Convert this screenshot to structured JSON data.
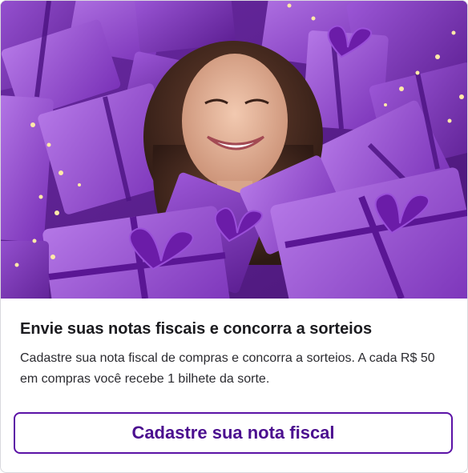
{
  "hero": {
    "image": "purple-gift-boxes-smiling-woman-photo"
  },
  "promo": {
    "title": "Envie suas notas fiscais e concorra a sorteios",
    "description": "Cadastre sua nota fiscal de compras e concorra a sorteios. A cada R$ 50 em compras você recebe 1 bilhete da sorte.",
    "cta_label": "Cadastre sua nota fiscal"
  },
  "colors": {
    "accent": "#5b12a6",
    "accent_text": "#4b0f8f",
    "gift_purple": "#8a3fc7",
    "title_text": "#1b1b1f"
  }
}
